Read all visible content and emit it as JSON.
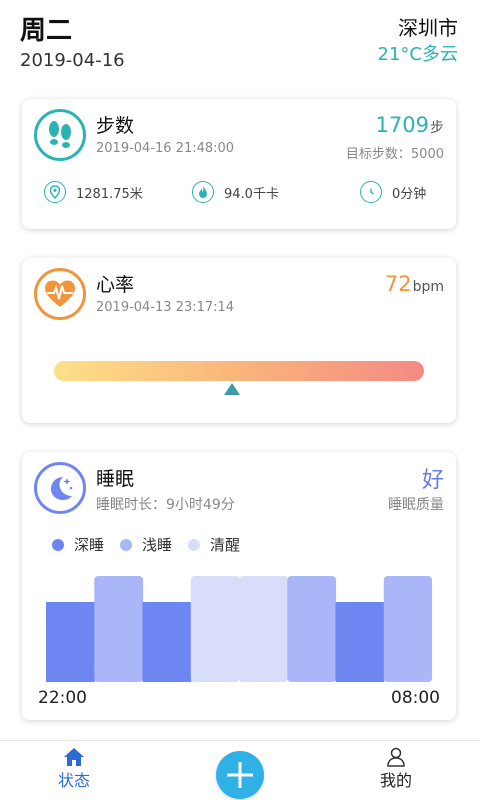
{
  "header": {
    "weekday": "周二",
    "date": "2019-04-16",
    "city": "深圳市",
    "weather": "21°C多云"
  },
  "steps": {
    "title": "步数",
    "timestamp": "2019-04-16 21:48:00",
    "value": "1709",
    "unit": "步",
    "goal": "目标步数：5000",
    "distance": "1281.75米",
    "calories": "94.0千卡",
    "duration": "0分钟",
    "icon": "footprints-icon",
    "accent_color": "#2bb3b3"
  },
  "heart_rate": {
    "title": "心率",
    "timestamp": "2019-04-13 23:17:14",
    "value": "72",
    "unit": "bpm",
    "marker_fraction": 0.48,
    "icon": "heart-pulse-icon",
    "accent_color": "#f2943c"
  },
  "sleep": {
    "title": "睡眠",
    "duration": "睡眠时长：9小时49分",
    "quality": "好",
    "quality_label": "睡眠质量",
    "legend": [
      "深睡",
      "浅睡",
      "清醒"
    ],
    "start_time": "22:00",
    "end_time": "08:00",
    "colors": {
      "deep": "#6e86f2",
      "light": "#a9b6f7",
      "awake": "#d8def9"
    },
    "segments": [
      "deep",
      "light",
      "deep",
      "awake",
      "awake",
      "light",
      "deep",
      "light"
    ],
    "icon": "moon-stars-icon"
  },
  "bottom_nav": {
    "status_label": "状态",
    "mine_label": "我的",
    "add_icon": "plus-icon"
  }
}
